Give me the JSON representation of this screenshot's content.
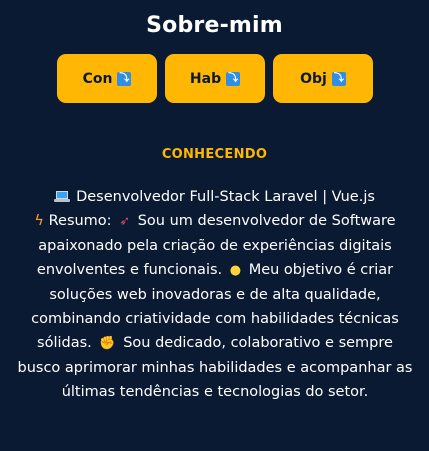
{
  "header": {
    "title": "Sobre-mim"
  },
  "nav": {
    "buttons": [
      {
        "label": "Con",
        "icon": "arrow-down-right-icon"
      },
      {
        "label": "Hab",
        "icon": "arrow-down-right-icon"
      },
      {
        "label": "Obj",
        "icon": "arrow-down-right-icon"
      }
    ]
  },
  "section": {
    "title": "CONHECENDO",
    "headline": "Desenvolvedor Full-Stack Laravel | Vue.js",
    "summary_label": "Resumo:",
    "summary_1": "Sou um desenvolvedor de Software apaixonado pela criação de experiências digitais envolventes e funcionais.",
    "summary_2": "Meu objetivo é criar soluções web inovadoras e de alta qualidade, combinando criatividade com habilidades técnicas sólidas.",
    "summary_3": "Sou dedicado, colaborativo e sempre busco aprimorar minhas habilidades e acompanhar as últimas tendências e tecnologias do setor."
  },
  "colors": {
    "background": "#0b1a33",
    "accent": "#ffb703",
    "button_text": "#0b1a33"
  }
}
